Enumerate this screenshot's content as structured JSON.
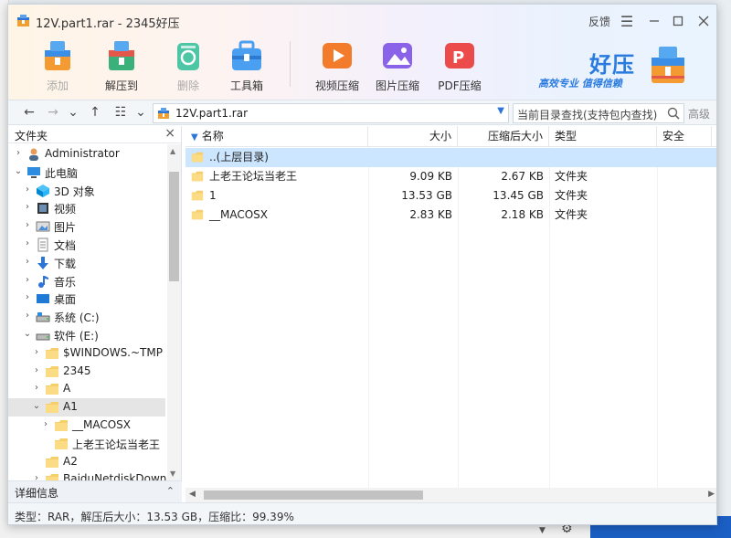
{
  "window": {
    "title": "12V.part1.rar - 2345好压",
    "feedback_label": "反馈"
  },
  "toolbar": {
    "items": [
      {
        "label": "添加",
        "icon": "add-archive-icon",
        "disabled": true
      },
      {
        "label": "解压到",
        "icon": "extract-to-icon",
        "disabled": false
      },
      {
        "label": "删除",
        "icon": "recycle-bin-icon",
        "disabled": true
      },
      {
        "label": "工具箱",
        "icon": "toolbox-icon",
        "disabled": false
      },
      {
        "label": "视频压缩",
        "icon": "video-compress-icon",
        "disabled": false
      },
      {
        "label": "图片压缩",
        "icon": "image-compress-icon",
        "disabled": false
      },
      {
        "label": "PDF压缩",
        "icon": "pdf-compress-icon",
        "disabled": false
      }
    ]
  },
  "brand": {
    "name": "好压",
    "slogan": "高效专业  值得信赖",
    "color": "#2a7be0"
  },
  "addressbar": {
    "path": "12V.part1.rar",
    "search_placeholder": "当前目录查找(支持包内查找)",
    "advanced_label": "高级"
  },
  "tree": {
    "header": "文件夹",
    "items": [
      {
        "label": "Administrator",
        "icon": "user-icon",
        "expander": "›"
      },
      {
        "label": "此电脑",
        "icon": "computer-icon",
        "expander": "⌄"
      },
      {
        "label": "3D 对象",
        "icon": "3d-objects-icon",
        "expander": "›"
      },
      {
        "label": "视频",
        "icon": "video-folder-icon",
        "expander": "›"
      },
      {
        "label": "图片",
        "icon": "pictures-folder-icon",
        "expander": "›"
      },
      {
        "label": "文档",
        "icon": "documents-folder-icon",
        "expander": "›"
      },
      {
        "label": "下载",
        "icon": "download-folder-icon",
        "expander": "›"
      },
      {
        "label": "音乐",
        "icon": "music-folder-icon",
        "expander": "›"
      },
      {
        "label": "桌面",
        "icon": "desktop-folder-icon",
        "expander": "›"
      },
      {
        "label": "系统 (C:)",
        "icon": "system-drive-icon",
        "expander": "›"
      },
      {
        "label": "软件 (E:)",
        "icon": "drive-icon",
        "expander": "⌄"
      },
      {
        "label": "$WINDOWS.~TMP",
        "icon": "folder-icon",
        "expander": "›"
      },
      {
        "label": "2345",
        "icon": "folder-icon",
        "expander": "›"
      },
      {
        "label": "A",
        "icon": "folder-icon",
        "expander": "›"
      },
      {
        "label": "A1",
        "icon": "folder-icon",
        "expander": "⌄"
      },
      {
        "label": "__MACOSX",
        "icon": "folder-icon",
        "expander": "›"
      },
      {
        "label": "上老王论坛当老王",
        "icon": "folder-icon",
        "expander": ""
      },
      {
        "label": "A2",
        "icon": "folder-icon",
        "expander": ""
      },
      {
        "label": "BaiduNetdiskDownl",
        "icon": "folder-icon",
        "expander": "›"
      }
    ]
  },
  "detail": {
    "label": "详细信息"
  },
  "list": {
    "columns": [
      "名称",
      "大小",
      "压缩后大小",
      "类型",
      "安全"
    ],
    "rows": [
      {
        "name": "..(上层目录)",
        "size": "",
        "packed": "",
        "type": ""
      },
      {
        "name": "上老王论坛当老王",
        "size": "9.09 KB",
        "packed": "2.67 KB",
        "type": "文件夹"
      },
      {
        "name": "1",
        "size": "13.53 GB",
        "packed": "13.45 GB",
        "type": "文件夹"
      },
      {
        "name": "__MACOSX",
        "size": "2.83 KB",
        "packed": "2.18 KB",
        "type": "文件夹"
      }
    ]
  },
  "status": {
    "text": "类型：RAR，解压后大小：13.53 GB，压缩比：99.39%"
  }
}
